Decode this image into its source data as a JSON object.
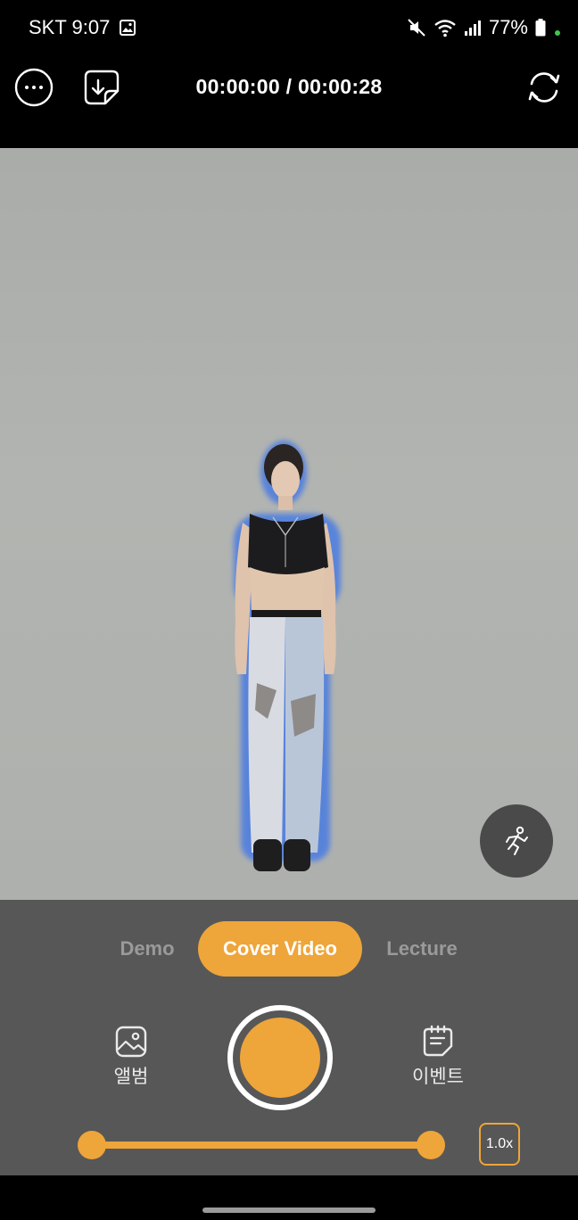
{
  "status_bar": {
    "carrier_time": "SKT 9:07",
    "battery": "77%",
    "icons": [
      "gallery-notification-icon",
      "mute-icon",
      "wifi-icon",
      "signal-icon",
      "battery-icon"
    ]
  },
  "toolbar": {
    "timecode": "00:00:00 / 00:00:28",
    "icons": [
      "more-options-icon",
      "download-icon",
      "switch-camera-icon"
    ]
  },
  "modes": {
    "tabs": [
      "Demo",
      "Cover Video",
      "Lecture"
    ],
    "active": "Cover Video"
  },
  "actions": {
    "album_label": "앨범",
    "event_label": "이벤트"
  },
  "speed": {
    "label": "1.0x",
    "range_start": 0.0,
    "range_end": 1.0
  },
  "colors": {
    "accent": "#EEA53A",
    "panel": "#575757",
    "preview_bg": "#ADAFAC"
  }
}
